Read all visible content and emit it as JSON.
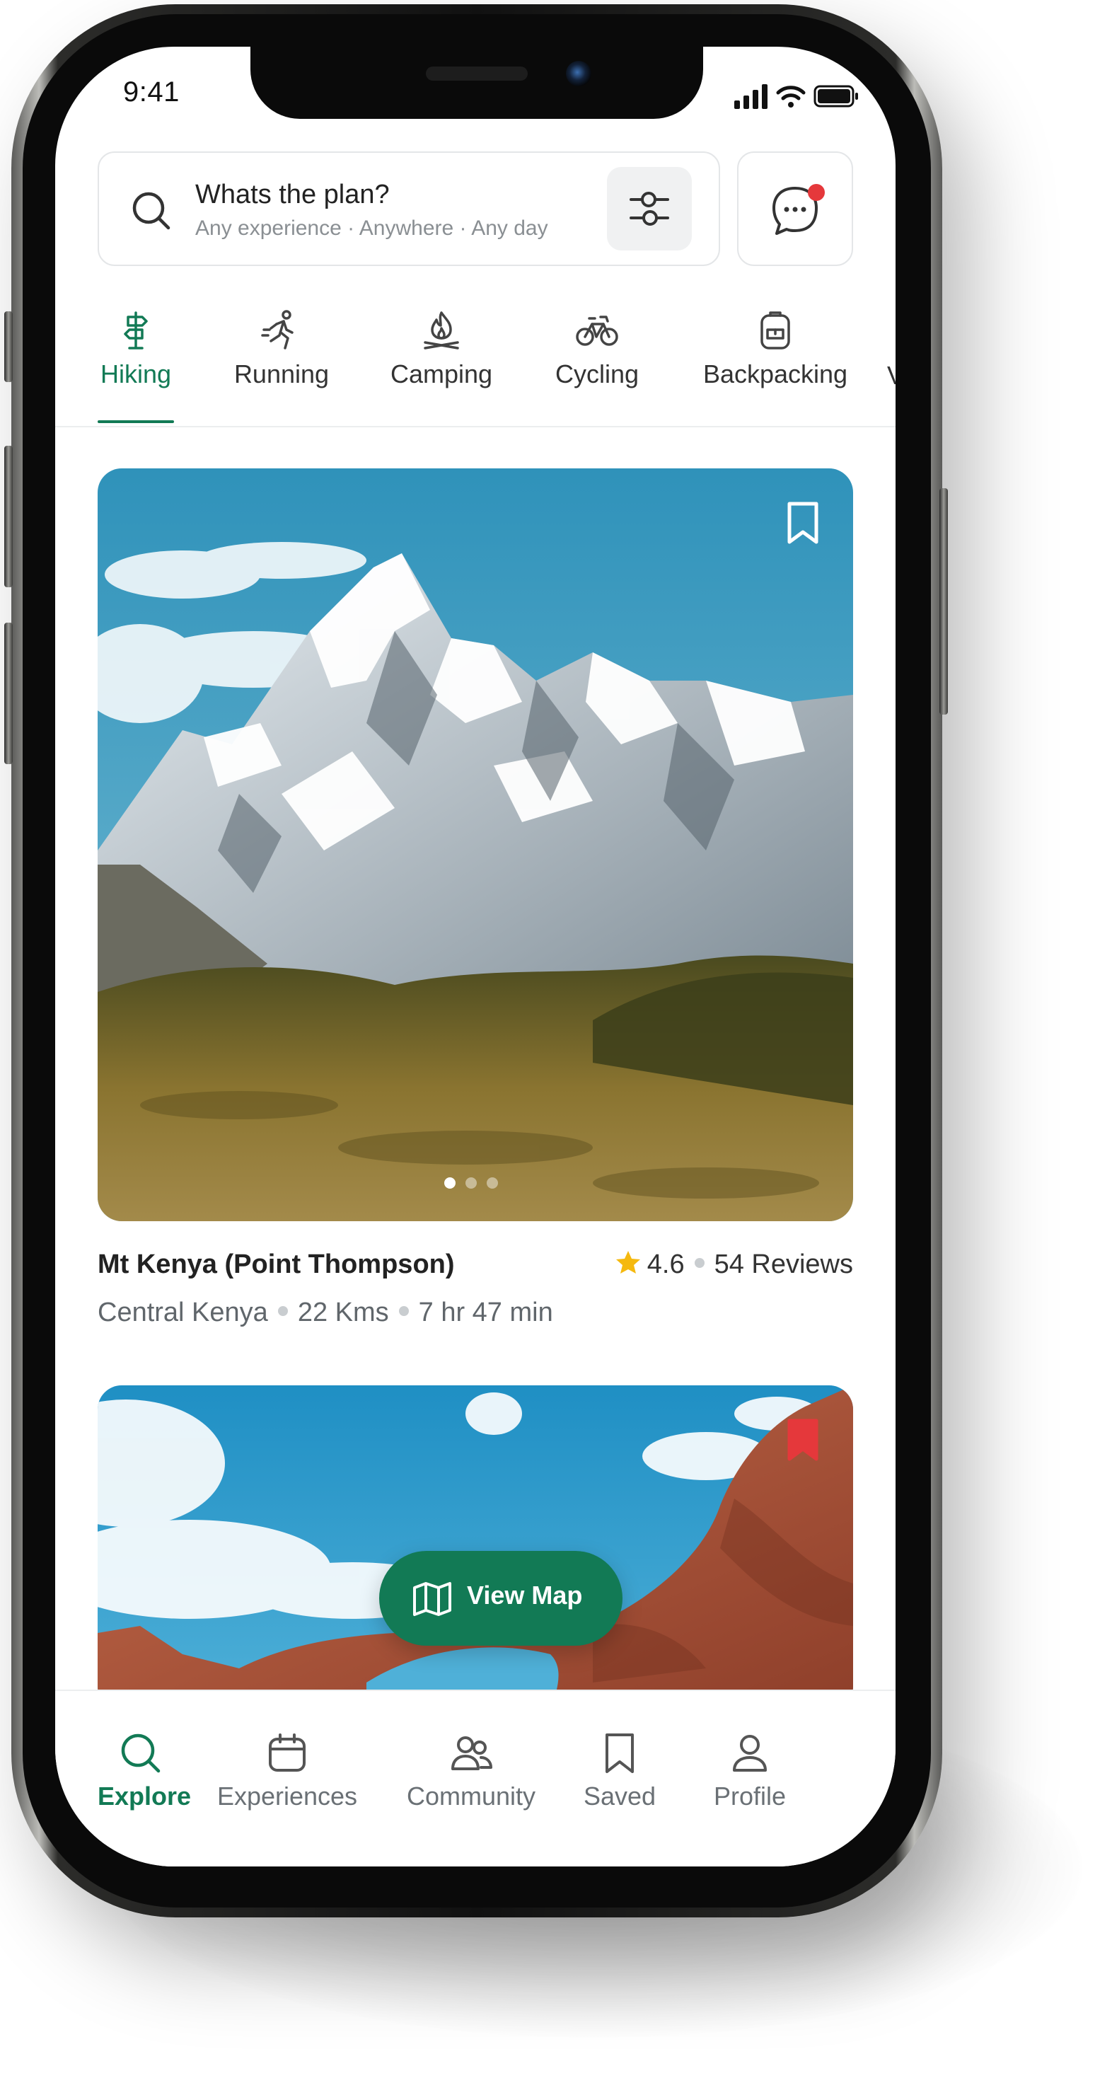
{
  "status_bar": {
    "time": "9:41"
  },
  "search": {
    "title": "Whats the plan?",
    "subtitle": "Any experience · Anywhere · Any day"
  },
  "categories": [
    {
      "label": "Hiking",
      "icon": "signpost-icon",
      "active": true
    },
    {
      "label": "Running",
      "icon": "runner-icon",
      "active": false
    },
    {
      "label": "Camping",
      "icon": "campfire-icon",
      "active": false
    },
    {
      "label": "Cycling",
      "icon": "bicycle-icon",
      "active": false
    },
    {
      "label": "Backpacking",
      "icon": "backpack-icon",
      "active": false
    }
  ],
  "listings": [
    {
      "title": "Mt Kenya (Point Thompson)",
      "rating": "4.6",
      "reviews": "54 Reviews",
      "location": "Central Kenya",
      "distance": "22 Kms",
      "duration": "7 hr 47 min",
      "saved": false,
      "image": "snowy-mountain-photo",
      "carousel_pages": 3,
      "carousel_active": 1
    },
    {
      "image": "red-rock-arch-photo",
      "saved": true
    }
  ],
  "view_map": {
    "label": "View Map"
  },
  "bottom_nav": [
    {
      "label": "Explore",
      "icon": "search-icon",
      "active": true
    },
    {
      "label": "Experiences",
      "icon": "calendar-icon",
      "active": false
    },
    {
      "label": "Community",
      "icon": "people-icon",
      "active": false
    },
    {
      "label": "Saved",
      "icon": "bookmark-icon",
      "active": false
    },
    {
      "label": "Profile",
      "icon": "user-icon",
      "active": false
    }
  ],
  "colors": {
    "accent": "#127a55",
    "notification": "#e5383b",
    "star": "#f5b90f",
    "saved_bookmark": "#e5383b"
  }
}
